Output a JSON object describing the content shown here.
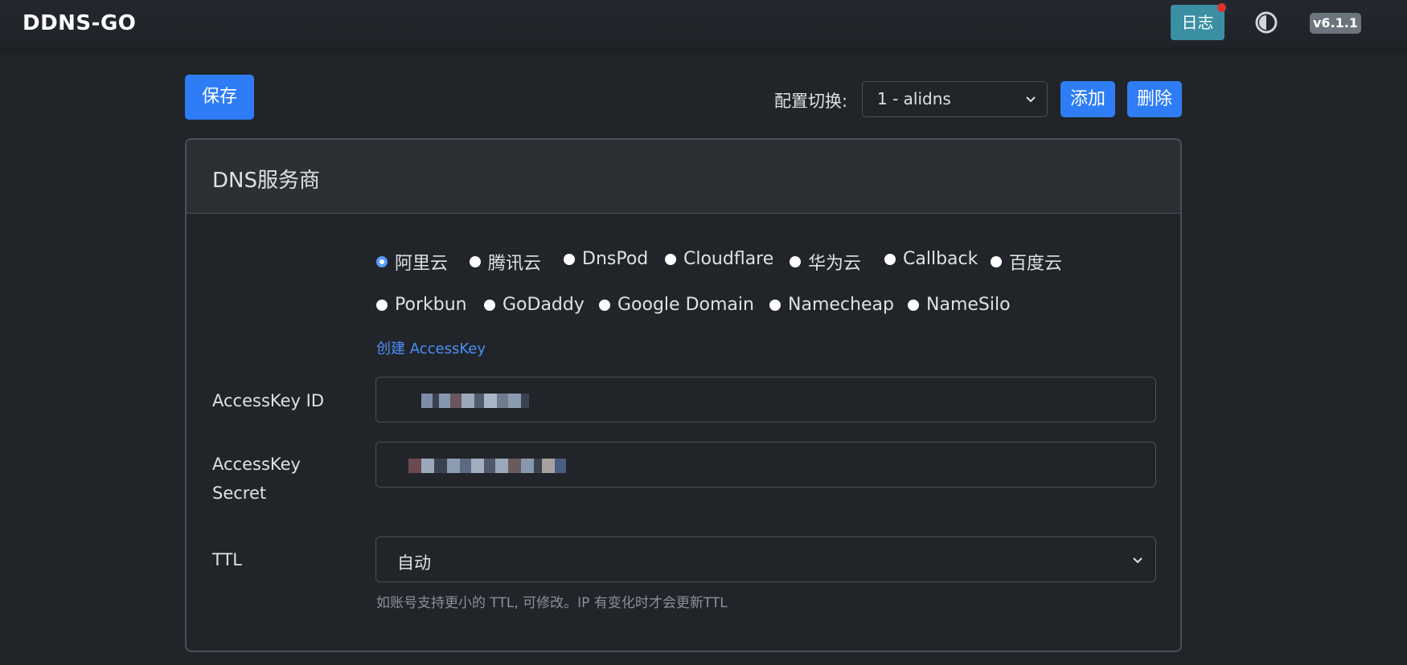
{
  "app": {
    "brand": "DDNS-GO",
    "log_button": "日志",
    "version": "v6.1.1",
    "theme_icon": "contrast-icon"
  },
  "toolbar": {
    "save_label": "保存",
    "config_label": "配置切换:",
    "config_selected": "1 - alidns",
    "add_label": "添加",
    "delete_label": "删除"
  },
  "card": {
    "title": "DNS服务商",
    "providers": [
      "阿里云",
      "腾讯云",
      "DnsPod",
      "Cloudflare",
      "华为云",
      "Callback",
      "百度云",
      "Porkbun",
      "GoDaddy",
      "Google Domain",
      "Namecheap",
      "NameSilo"
    ],
    "selected_provider": "阿里云",
    "create_link": "创建 AccessKey",
    "fields": {
      "access_key_id_label": "AccessKey ID",
      "access_key_secret_label": "AccessKey Secret",
      "ttl_label": "TTL",
      "ttl_value": "自动",
      "ttl_help": "如账号支持更小的 TTL, 可修改。IP 有变化时才会更新TTL"
    }
  },
  "colors": {
    "accent": "#2f7df6",
    "log_button": "#3a8fa3",
    "notification_dot": "#e03131",
    "background": "#212529"
  }
}
